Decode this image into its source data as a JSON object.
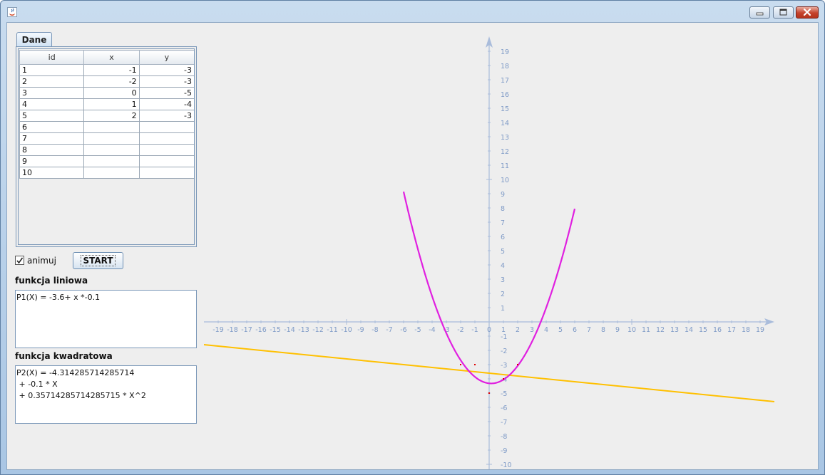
{
  "window": {
    "icon": "java-cup-icon",
    "controls": [
      "minimize-icon",
      "maximize-icon",
      "close-icon"
    ]
  },
  "tab": {
    "label": "Dane"
  },
  "table": {
    "columns": [
      "id",
      "x",
      "y"
    ],
    "rows": [
      [
        "1",
        "-1",
        "-3"
      ],
      [
        "2",
        "-2",
        "-3"
      ],
      [
        "3",
        "0",
        "-5"
      ],
      [
        "4",
        "1",
        "-4"
      ],
      [
        "5",
        "2",
        "-3"
      ],
      [
        "6",
        "",
        ""
      ],
      [
        "7",
        "",
        ""
      ],
      [
        "8",
        "",
        ""
      ],
      [
        "9",
        "",
        ""
      ],
      [
        "10",
        "",
        ""
      ]
    ]
  },
  "controls": {
    "animate_label": "animuj",
    "animate_checked": true,
    "start_label": "START"
  },
  "linear": {
    "label": "funkcja liniowa",
    "formula": "P1(X) = -3.6+ x *-0.1"
  },
  "quadratic": {
    "label": "funkcja kwadratowa",
    "formula": "P2(X) = -4.314285714285714\n + -0.1 * X\n + 0.35714285714285715 * X^2"
  },
  "chart_data": {
    "type": "line",
    "xlim": [
      -19,
      19
    ],
    "ylim": [
      -10,
      19
    ],
    "x_ticks": [
      -19,
      -18,
      -17,
      -16,
      -15,
      -14,
      -13,
      -12,
      -11,
      -10,
      -9,
      -8,
      -7,
      -6,
      -5,
      -4,
      -3,
      -2,
      -1,
      0,
      1,
      2,
      3,
      4,
      5,
      6,
      7,
      8,
      9,
      10,
      11,
      12,
      13,
      14,
      15,
      16,
      17,
      18,
      19
    ],
    "y_ticks": [
      -10,
      -9,
      -8,
      -7,
      -6,
      -5,
      -4,
      -3,
      -2,
      -1,
      1,
      2,
      3,
      4,
      5,
      6,
      7,
      8,
      9,
      10,
      11,
      12,
      13,
      14,
      15,
      16,
      17,
      18,
      19
    ],
    "axis_color": "#a9bcdb",
    "tick_label_color": "#7f9bc7",
    "series": [
      {
        "kind": "linear",
        "a": -3.6,
        "b": -0.1,
        "color": "#ffc000"
      },
      {
        "kind": "quadratic",
        "c": -4.314285714285714,
        "b": -0.1,
        "a": 0.35714285714285715,
        "color": "#e020e0"
      }
    ],
    "points": [
      {
        "x": -1,
        "y": -3
      },
      {
        "x": -2,
        "y": -3
      },
      {
        "x": 0,
        "y": -5
      },
      {
        "x": 1,
        "y": -4
      },
      {
        "x": 2,
        "y": -3
      }
    ],
    "point_color": "#e00000"
  }
}
